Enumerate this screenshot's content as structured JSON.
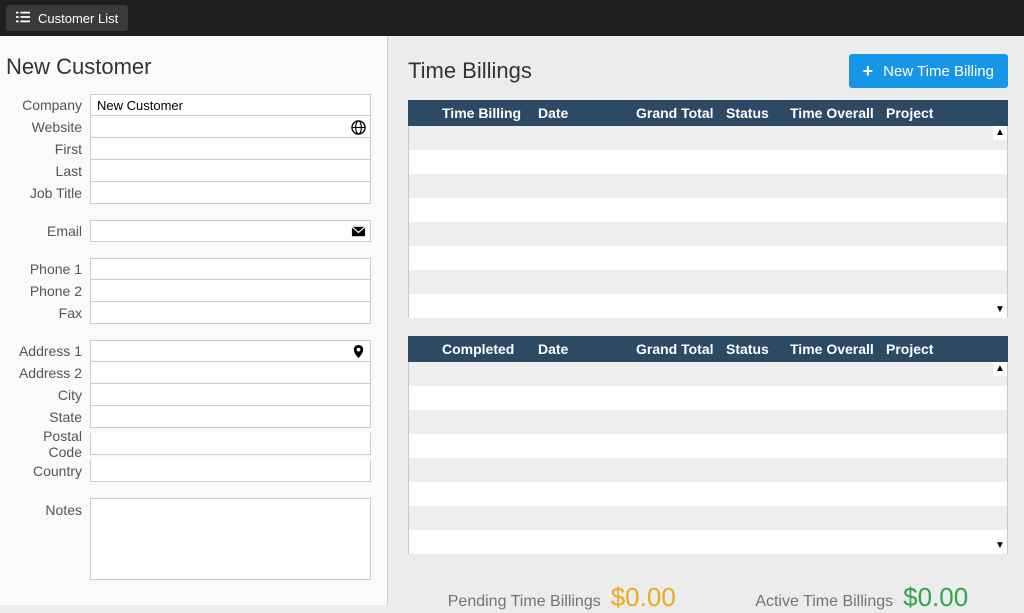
{
  "topbar": {
    "list_button": "Customer List"
  },
  "left": {
    "title": "New Customer",
    "fields": {
      "company_label": "Company",
      "company_value": "New Customer",
      "website_label": "Website",
      "website_value": "",
      "first_label": "First",
      "first_value": "",
      "last_label": "Last",
      "last_value": "",
      "jobtitle_label": "Job Title",
      "jobtitle_value": "",
      "email_label": "Email",
      "email_value": "",
      "phone1_label": "Phone 1",
      "phone1_value": "",
      "phone2_label": "Phone 2",
      "phone2_value": "",
      "fax_label": "Fax",
      "fax_value": "",
      "address1_label": "Address 1",
      "address1_value": "",
      "address2_label": "Address 2",
      "address2_value": "",
      "city_label": "City",
      "city_value": "",
      "state_label": "State",
      "state_value": "",
      "postal_label": "Postal Code",
      "postal_value": "",
      "country_label": "Country",
      "country_value": "",
      "notes_label": "Notes",
      "notes_value": ""
    }
  },
  "right": {
    "title": "Time Billings",
    "new_button": "New Time Billing",
    "table1": {
      "cols": {
        "c1": "Time Billing",
        "c2": "Date",
        "c3": "Grand Total",
        "c4": "Status",
        "c5": "Time Overall",
        "c6": "Project"
      }
    },
    "table2": {
      "cols": {
        "c1": "Completed",
        "c2": "Date",
        "c3": "Grand Total",
        "c4": "Status",
        "c5": "Time Overall",
        "c6": "Project"
      }
    },
    "totals": {
      "pending_label": "Pending Time Billings",
      "pending_value": "$0.00",
      "active_label": "Active Time Billings",
      "active_value": "$0.00"
    }
  }
}
